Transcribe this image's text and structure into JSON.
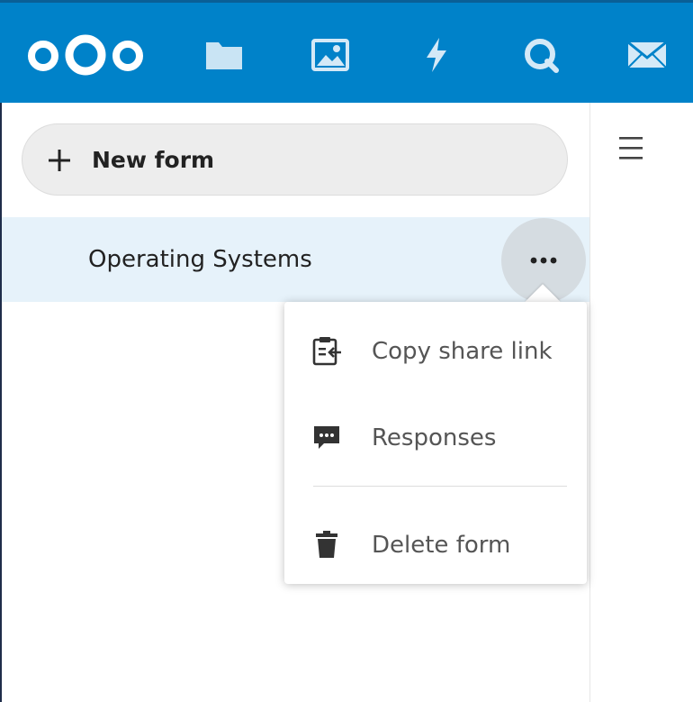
{
  "header": {
    "background_color": "#0082c9",
    "logo": "nextcloud-logo",
    "nav_icons": [
      "files-icon",
      "photos-icon",
      "activity-icon",
      "search-icon",
      "mail-icon"
    ]
  },
  "navigation": {
    "new_form_label": "New form",
    "forms": [
      {
        "title": "Operating Systems",
        "selected": true
      }
    ]
  },
  "actions_menu": {
    "items": [
      {
        "label": "Copy share link",
        "icon": "clipboard-share-icon"
      },
      {
        "label": "Responses",
        "icon": "comment-icon"
      },
      {
        "label": "Delete form",
        "icon": "trash-icon"
      }
    ]
  },
  "toolbar": {
    "menu_toggle_icon": "hamburger-icon"
  }
}
